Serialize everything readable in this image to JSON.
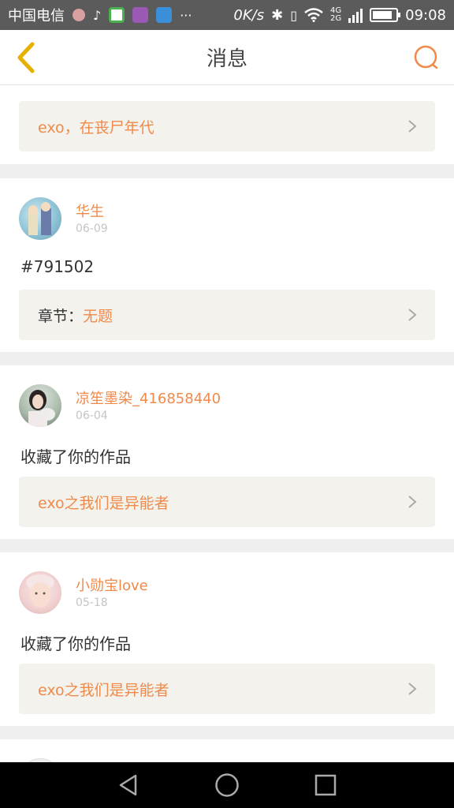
{
  "status_bar": {
    "carrier": "中国电信",
    "speed": "0K/s",
    "network_top": "4G",
    "network_bottom": "2G",
    "time": "09:08",
    "battery_fraction": 0.85
  },
  "header": {
    "title": "消息",
    "back_icon": "chevron-left-icon",
    "search_icon": "search-icon"
  },
  "colors": {
    "accent": "#f08a4b",
    "back_icon": "#e5b000",
    "link_bg": "#f3f2ec"
  },
  "messages": [
    {
      "link": {
        "label": "",
        "value": "exo，在丧尸年代"
      }
    },
    {
      "user": "华生",
      "date": "06-09",
      "text": "#791502",
      "link": {
        "label": "章节：",
        "value": "无题"
      }
    },
    {
      "user": "凉笙墨染_416858440",
      "date": "06-04",
      "text": "收藏了你的作品",
      "link": {
        "label": "",
        "value": "exo之我们是异能者"
      }
    },
    {
      "user": "小勋宝love",
      "date": "05-18",
      "text": "收藏了你的作品",
      "link": {
        "label": "",
        "value": "exo之我们是异能者"
      }
    }
  ],
  "nav": {
    "back": "triangle-back-icon",
    "home": "circle-home-icon",
    "recents": "square-recents-icon"
  }
}
